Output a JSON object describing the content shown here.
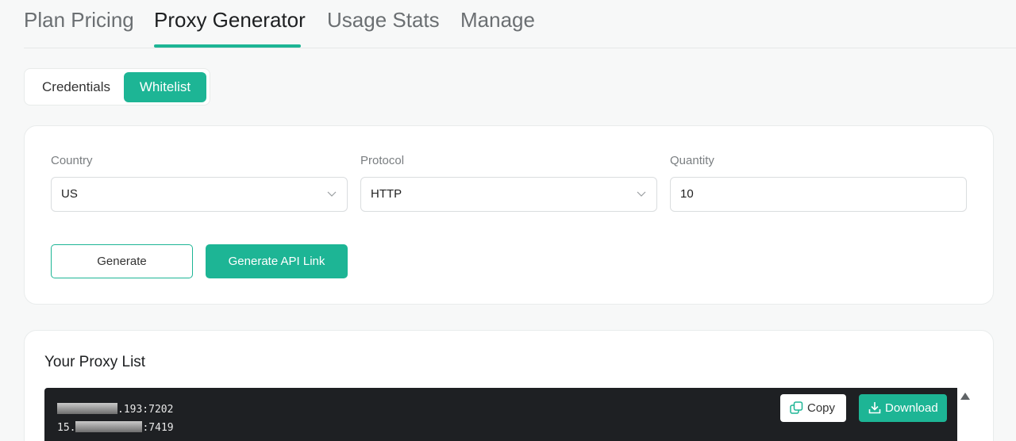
{
  "tabs": [
    {
      "label": "Plan Pricing",
      "active": false
    },
    {
      "label": "Proxy Generator",
      "active": true
    },
    {
      "label": "Usage Stats",
      "active": false
    },
    {
      "label": "Manage",
      "active": false
    }
  ],
  "auth_mode": {
    "options": [
      "Credentials",
      "Whitelist"
    ],
    "selected": "Whitelist"
  },
  "form": {
    "country": {
      "label": "Country",
      "value": "US"
    },
    "protocol": {
      "label": "Protocol",
      "value": "HTTP"
    },
    "quantity": {
      "label": "Quantity",
      "value": "10"
    },
    "generate_label": "Generate",
    "generate_api_label": "Generate API Link"
  },
  "proxy_list": {
    "title": "Your Proxy List",
    "copy_label": "Copy",
    "download_label": "Download",
    "lines": [
      {
        "prefix": "",
        "suffix": ".193:7202"
      },
      {
        "prefix": "15.",
        "suffix": ":7419"
      }
    ]
  },
  "colors": {
    "accent": "#1db595",
    "console_bg": "#1e2023"
  }
}
